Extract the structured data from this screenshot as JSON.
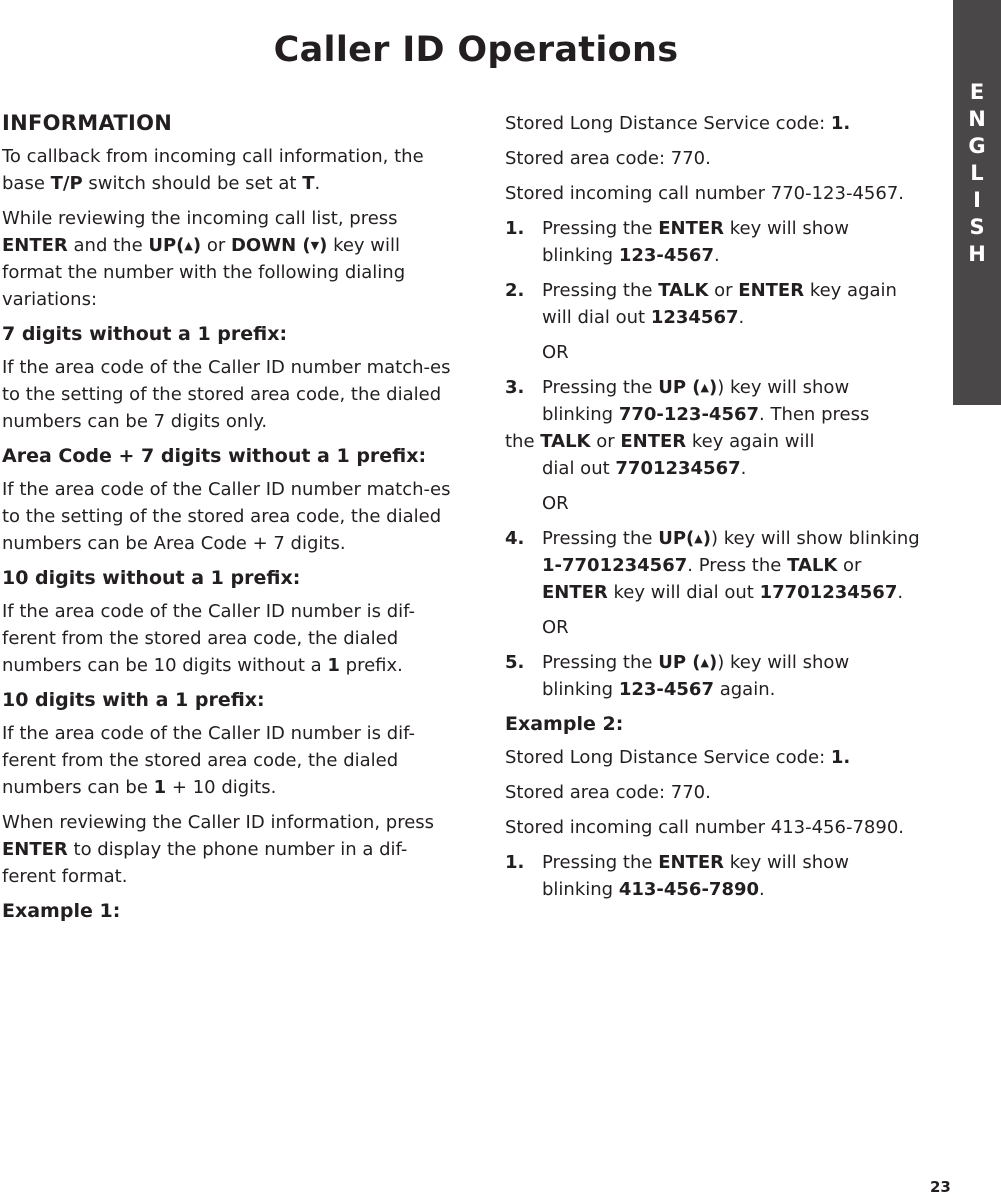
{
  "page": {
    "title": "Caller ID Operations",
    "side_tab": [
      "E",
      "N",
      "G",
      "L",
      "I",
      "S",
      "H"
    ],
    "page_number": "23"
  },
  "left": {
    "heading": "INFORMATION",
    "p1": {
      "a": "To callback from incoming call information, the base ",
      "b1": "T/P",
      "c": " switch should be set at ",
      "b2": "T",
      "d": "."
    },
    "p2": {
      "b1": "ENTER",
      "a0": "While reviewing the incoming call list, press ",
      "a": " and the ",
      "b2": "UP(",
      "up": "▲",
      "b2c": ")",
      "c": " or ",
      "b3": "DOWN (",
      "down": "▼",
      "b3c": ")",
      "d": " key will format the number with the following dialing variations:"
    },
    "s1": {
      "heading": "7 digits without a 1 prefix:",
      "text": "If the area code of the Caller ID number match-es to the setting of the stored area code, the dialed numbers can be 7 digits only."
    },
    "s2": {
      "heading": "Area Code + 7 digits without a 1 prefix:",
      "text": "If the area code of the Caller ID number match-es to the setting of the stored area code, the dialed numbers can be Area Code + 7 digits."
    },
    "s3": {
      "heading": "10 digits without a 1 prefix:",
      "a": "If the area code of the Caller ID number is dif-ferent from the stored area code, the dialed numbers can be 10 digits without a ",
      "b": "1",
      "c": " prefix."
    },
    "s4": {
      "heading": "10 digits with a 1 prefix:",
      "a": "If the area code of the Caller ID number is dif-ferent from the stored area code, the dialed numbers can be ",
      "b": "1",
      "c": " + 10 digits."
    },
    "p3": {
      "a": "When reviewing the Caller ID information, press ",
      "b": "ENTER",
      "c": " to display the phone number in a dif-ferent format."
    },
    "example1": "Example 1:"
  },
  "right": {
    "ex1": {
      "ld_label": "Stored Long Distance Service code: ",
      "ld_value": "1.",
      "area": "Stored area code: 770.",
      "incoming": "Stored incoming call number 770-123-4567.",
      "steps": [
        {
          "num": "1.",
          "a": "Pressing the ",
          "b": "ENTER",
          "c": " key will show blinking ",
          "d": "123-4567",
          "e": "."
        },
        {
          "num": "2.",
          "a": "Pressing the ",
          "b": "TALK",
          "c": " or ",
          "d": "ENTER",
          "e": " key again will dial out ",
          "f": "1234567",
          "g": "."
        },
        {
          "num": "3.",
          "a": "Pressing the ",
          "b": "UP (",
          "c": ") key will show blinking ",
          "d": "770-123-4567",
          "e": ". Then press",
          "f": "the ",
          "g": "TALK",
          "h": " or ",
          "i": "ENTER",
          "j": " key again will",
          "k": "dial out ",
          "l": "7701234567",
          "m": "."
        },
        {
          "num": "4.",
          "a": "Pressing the ",
          "b": "UP(",
          "c": ") key will show blinking ",
          "d": "1-7701234567",
          "e": ". Press the ",
          "f": "TALK",
          "g": " or ",
          "h": "ENTER",
          "i": " key will dial out ",
          "j": "17701234567",
          "k": "."
        },
        {
          "num": "5.",
          "a": "Pressing the ",
          "b": "UP (",
          "c": ") key will show blinking ",
          "d": "123-4567",
          "e": " again."
        }
      ],
      "or": "OR",
      "up_arrow": "▲"
    },
    "ex2": {
      "heading": "Example 2:",
      "ld_label": "Stored Long Distance Service code: ",
      "ld_value": "1.",
      "area": "Stored area code: 770.",
      "incoming": "Stored incoming call number 413-456-7890.",
      "steps": [
        {
          "num": "1.",
          "a": "Pressing the ",
          "b": "ENTER",
          "c": " key will show blinking ",
          "d": "413-456-7890",
          "e": "."
        }
      ]
    }
  }
}
